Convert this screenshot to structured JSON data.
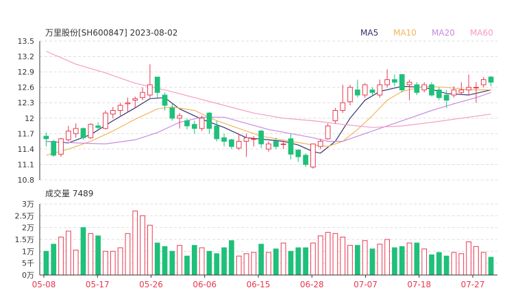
{
  "header": {
    "title": "万里股份[SH600847] 2023-08-02",
    "ma_legend": [
      {
        "label": "MA5",
        "color": "#2f2f6e"
      },
      {
        "label": "MA10",
        "color": "#f3b35a"
      },
      {
        "label": "MA20",
        "color": "#c689e0"
      },
      {
        "label": "MA60",
        "color": "#f49ac6"
      }
    ]
  },
  "colors": {
    "up": "#e8384f",
    "down": "#1ec07a",
    "grid": "#dddddd",
    "axis": "#333333"
  },
  "chart_data": [
    {
      "type": "candlestick",
      "ylim": [
        10.8,
        13.5
      ],
      "yticks": [
        "13.5",
        "13.2",
        "12.9",
        "12.6",
        "12.3",
        "12",
        "11.7",
        "11.4",
        "11.1",
        "10.8"
      ],
      "xticks": [
        "05-08",
        "05-17",
        "05-26",
        "06-06",
        "06-15",
        "06-28",
        "07-07",
        "07-18",
        "07-27"
      ],
      "candles": [
        [
          11.65,
          11.6,
          11.72,
          11.45
        ],
        [
          11.55,
          11.28,
          11.58,
          11.25
        ],
        [
          11.3,
          11.6,
          11.62,
          11.25
        ],
        [
          11.58,
          11.75,
          11.85,
          11.55
        ],
        [
          11.7,
          11.8,
          11.9,
          11.62
        ],
        [
          11.8,
          11.62,
          11.82,
          11.58
        ],
        [
          11.62,
          11.88,
          11.9,
          11.6
        ],
        [
          11.85,
          11.82,
          11.92,
          11.75
        ],
        [
          11.8,
          12.1,
          12.15,
          11.78
        ],
        [
          12.08,
          12.15,
          12.22,
          12.0
        ],
        [
          12.15,
          12.25,
          12.3,
          12.05
        ],
        [
          12.28,
          12.3,
          12.4,
          12.12
        ],
        [
          12.35,
          12.38,
          12.42,
          12.2
        ],
        [
          12.4,
          12.5,
          12.6,
          12.35
        ],
        [
          12.45,
          12.65,
          13.05,
          12.4
        ],
        [
          12.8,
          12.5,
          12.8,
          12.4
        ],
        [
          12.45,
          12.25,
          12.5,
          12.15
        ],
        [
          12.2,
          12.0,
          12.28,
          11.95
        ],
        [
          12.0,
          12.05,
          12.1,
          11.8
        ],
        [
          11.95,
          11.85,
          12.0,
          11.78
        ],
        [
          11.88,
          11.8,
          11.95,
          11.7
        ],
        [
          11.8,
          12.0,
          12.05,
          11.75
        ],
        [
          12.1,
          11.8,
          12.12,
          11.7
        ],
        [
          11.85,
          11.6,
          11.95,
          11.55
        ],
        [
          11.62,
          11.55,
          11.7,
          11.45
        ],
        [
          11.58,
          11.45,
          11.6,
          11.4
        ],
        [
          11.42,
          11.55,
          11.7,
          11.38
        ],
        [
          11.55,
          11.62,
          11.7,
          11.25
        ],
        [
          11.6,
          11.6,
          11.65,
          11.45
        ],
        [
          11.75,
          11.5,
          11.78,
          11.42
        ],
        [
          11.4,
          11.5,
          11.55,
          11.35
        ],
        [
          11.55,
          11.45,
          11.62,
          11.4
        ],
        [
          11.5,
          11.5,
          11.55,
          11.4
        ],
        [
          11.6,
          11.3,
          11.7,
          11.2
        ],
        [
          11.38,
          11.25,
          11.4,
          11.15
        ],
        [
          11.28,
          11.1,
          11.32,
          11.05
        ],
        [
          11.05,
          11.5,
          11.5,
          11.02
        ],
        [
          11.45,
          11.55,
          11.6,
          11.4
        ],
        [
          11.6,
          11.85,
          11.9,
          11.58
        ],
        [
          11.95,
          12.15,
          12.2,
          11.9
        ],
        [
          12.15,
          12.3,
          12.65,
          12.1
        ],
        [
          12.32,
          12.6,
          12.65,
          12.25
        ],
        [
          12.55,
          12.45,
          12.75,
          12.4
        ],
        [
          12.45,
          12.65,
          12.68,
          12.4
        ],
        [
          12.55,
          12.5,
          12.6,
          12.42
        ],
        [
          12.45,
          12.65,
          12.75,
          12.4
        ],
        [
          12.65,
          12.75,
          12.95,
          12.6
        ],
        [
          12.75,
          12.7,
          12.85,
          12.62
        ],
        [
          12.85,
          12.55,
          12.85,
          12.5
        ],
        [
          12.65,
          12.7,
          12.75,
          12.35
        ],
        [
          12.65,
          12.5,
          12.7,
          12.45
        ],
        [
          12.55,
          12.65,
          12.7,
          12.5
        ],
        [
          12.65,
          12.45,
          12.7,
          12.42
        ],
        [
          12.55,
          12.4,
          12.6,
          12.35
        ],
        [
          12.45,
          12.35,
          12.55,
          12.2
        ],
        [
          12.45,
          12.55,
          12.62,
          12.4
        ],
        [
          12.5,
          12.55,
          12.7,
          12.45
        ],
        [
          12.55,
          12.6,
          12.85,
          12.45
        ],
        [
          12.6,
          12.6,
          12.7,
          12.3
        ],
        [
          12.65,
          12.75,
          12.8,
          12.6
        ],
        [
          12.8,
          12.7,
          12.82,
          12.62
        ]
      ],
      "ma": [
        {
          "name": "MA5",
          "color": "#2f2f6e",
          "points": [
            [
              0,
              11.55
            ],
            [
              3,
              11.52
            ],
            [
              6,
              11.68
            ],
            [
              9,
              11.95
            ],
            [
              12,
              12.2
            ],
            [
              14,
              12.38
            ],
            [
              16,
              12.4
            ],
            [
              18,
              12.18
            ],
            [
              21,
              11.98
            ],
            [
              24,
              11.82
            ],
            [
              27,
              11.62
            ],
            [
              30,
              11.58
            ],
            [
              32,
              11.55
            ],
            [
              34,
              11.48
            ],
            [
              36,
              11.35
            ],
            [
              37,
              11.32
            ],
            [
              39,
              11.55
            ],
            [
              41,
              12.0
            ],
            [
              43,
              12.35
            ],
            [
              45,
              12.52
            ],
            [
              48,
              12.62
            ],
            [
              51,
              12.6
            ],
            [
              54,
              12.48
            ],
            [
              57,
              12.45
            ],
            [
              60,
              12.55
            ]
          ]
        },
        {
          "name": "MA10",
          "color": "#f3b35a",
          "points": [
            [
              0,
              11.28
            ],
            [
              3,
              11.4
            ],
            [
              6,
              11.55
            ],
            [
              9,
              11.75
            ],
            [
              12,
              11.98
            ],
            [
              15,
              12.18
            ],
            [
              17,
              12.22
            ],
            [
              20,
              12.15
            ],
            [
              23,
              11.95
            ],
            [
              26,
              11.8
            ],
            [
              29,
              11.65
            ],
            [
              33,
              11.55
            ],
            [
              36,
              11.48
            ],
            [
              38,
              11.45
            ],
            [
              40,
              11.55
            ],
            [
              42,
              11.78
            ],
            [
              44,
              12.05
            ],
            [
              46,
              12.35
            ],
            [
              48,
              12.52
            ],
            [
              51,
              12.62
            ],
            [
              54,
              12.6
            ],
            [
              57,
              12.55
            ],
            [
              60,
              12.55
            ]
          ]
        },
        {
          "name": "MA20",
          "color": "#c689e0",
          "points": [
            [
              0,
              11.55
            ],
            [
              4,
              11.52
            ],
            [
              8,
              11.5
            ],
            [
              12,
              11.58
            ],
            [
              15,
              11.72
            ],
            [
              18,
              11.92
            ],
            [
              21,
              12.02
            ],
            [
              24,
              12.02
            ],
            [
              27,
              11.9
            ],
            [
              30,
              11.78
            ],
            [
              33,
              11.7
            ],
            [
              36,
              11.62
            ],
            [
              38,
              11.55
            ],
            [
              40,
              11.55
            ],
            [
              43,
              11.7
            ],
            [
              46,
              11.85
            ],
            [
              49,
              12.0
            ],
            [
              52,
              12.15
            ],
            [
              55,
              12.28
            ],
            [
              58,
              12.4
            ],
            [
              60,
              12.5
            ]
          ]
        },
        {
          "name": "MA60",
          "color": "#f49ac6",
          "points": [
            [
              0,
              13.3
            ],
            [
              4,
              13.05
            ],
            [
              8,
              12.88
            ],
            [
              12,
              12.68
            ],
            [
              16,
              12.55
            ],
            [
              20,
              12.4
            ],
            [
              24,
              12.25
            ],
            [
              28,
              12.1
            ],
            [
              32,
              12.0
            ],
            [
              36,
              11.95
            ],
            [
              40,
              11.88
            ],
            [
              44,
              11.82
            ],
            [
              48,
              11.85
            ],
            [
              52,
              11.92
            ],
            [
              56,
              12.0
            ],
            [
              60,
              12.08
            ]
          ]
        }
      ]
    },
    {
      "type": "bar",
      "title": "成交量 7489",
      "unit": "万",
      "ylim": [
        0,
        3
      ],
      "yticks": [
        "3万",
        "2.5万",
        "2万",
        "1.5万",
        "1万",
        "5千",
        "0万"
      ],
      "values": [
        1.0,
        1.3,
        1.6,
        1.85,
        1.05,
        2.0,
        1.75,
        1.65,
        1.0,
        1.0,
        1.15,
        1.75,
        2.7,
        2.5,
        2.1,
        1.35,
        1.2,
        1.0,
        1.25,
        0.8,
        1.25,
        1.15,
        1.0,
        0.9,
        1.15,
        1.45,
        0.8,
        0.9,
        0.95,
        1.3,
        0.95,
        1.1,
        1.35,
        1.0,
        1.15,
        1.15,
        1.35,
        1.65,
        1.8,
        1.75,
        1.6,
        1.25,
        1.25,
        1.45,
        1.1,
        1.3,
        1.5,
        1.15,
        1.2,
        1.35,
        1.35,
        1.1,
        0.85,
        0.95,
        0.8,
        0.95,
        0.9,
        1.4,
        1.2,
        0.95,
        0.75
      ]
    }
  ]
}
